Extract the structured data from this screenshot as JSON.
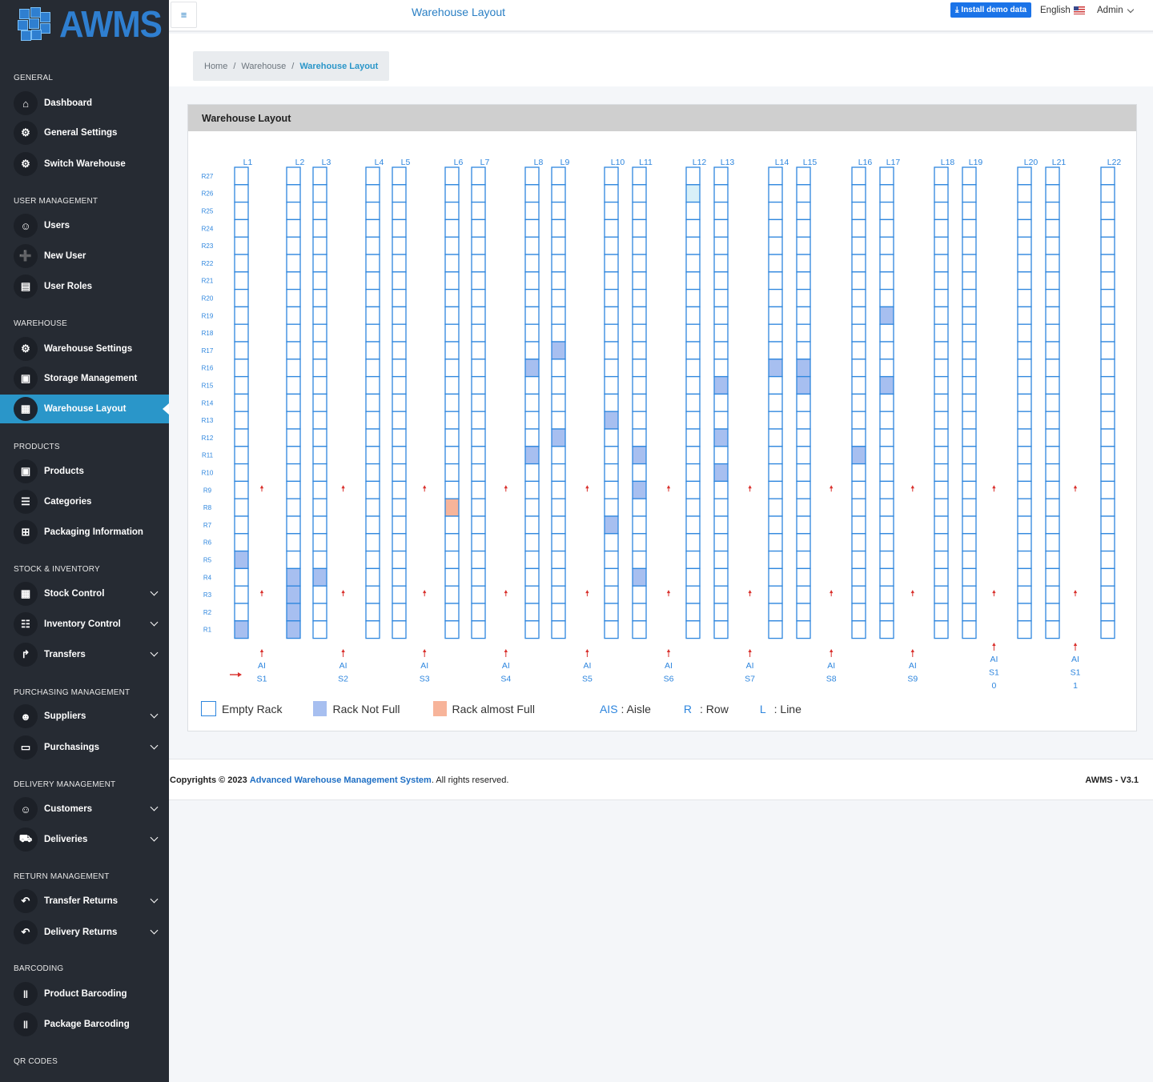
{
  "brand": {
    "name": "AWMS"
  },
  "topbar": {
    "title": "Warehouse Layout",
    "demo_button": "Install demo data",
    "language": "English",
    "user": "Admin"
  },
  "breadcrumb": {
    "home": "Home",
    "sep1": "/",
    "parent": "Warehouse",
    "sep2": "/",
    "current": "Warehouse Layout"
  },
  "sidebar": {
    "sections": [
      {
        "title": "GENERAL",
        "items": [
          {
            "label": "Dashboard",
            "icon": "home-icon"
          },
          {
            "label": "General Settings",
            "icon": "gear-icon"
          },
          {
            "label": "Switch Warehouse",
            "icon": "gear-icon"
          }
        ]
      },
      {
        "title": "USER MANAGEMENT",
        "items": [
          {
            "label": "Users",
            "icon": "users-icon"
          },
          {
            "label": "New User",
            "icon": "user-plus-icon"
          },
          {
            "label": "User Roles",
            "icon": "id-card-icon"
          }
        ]
      },
      {
        "title": "WAREHOUSE",
        "items": [
          {
            "label": "Warehouse Settings",
            "icon": "gear-icon"
          },
          {
            "label": "Storage Management",
            "icon": "box-icon"
          },
          {
            "label": "Warehouse Layout",
            "icon": "grid-icon",
            "active": true
          }
        ]
      },
      {
        "title": "PRODUCTS",
        "items": [
          {
            "label": "Products",
            "icon": "box-icon"
          },
          {
            "label": "Categories",
            "icon": "list-icon"
          },
          {
            "label": "Packaging Information",
            "icon": "table-icon"
          }
        ]
      },
      {
        "title": "STOCK & INVENTORY",
        "items": [
          {
            "label": "Stock Control",
            "icon": "grid-icon",
            "expandable": true
          },
          {
            "label": "Inventory Control",
            "icon": "server-icon",
            "expandable": true
          },
          {
            "label": "Transfers",
            "icon": "share-icon",
            "expandable": true
          }
        ]
      },
      {
        "title": "PURCHASING MANAGEMENT",
        "items": [
          {
            "label": "Suppliers",
            "icon": "user-group-icon",
            "expandable": true
          },
          {
            "label": "Purchasings",
            "icon": "credit-card-icon",
            "expandable": true
          }
        ]
      },
      {
        "title": "DELIVERY MANAGEMENT",
        "items": [
          {
            "label": "Customers",
            "icon": "users-icon",
            "expandable": true
          },
          {
            "label": "Deliveries",
            "icon": "truck-icon",
            "expandable": true
          }
        ]
      },
      {
        "title": "RETURN MANAGEMENT",
        "items": [
          {
            "label": "Transfer Returns",
            "icon": "undo-icon",
            "expandable": true
          },
          {
            "label": "Delivery Returns",
            "icon": "undo-icon",
            "expandable": true
          }
        ]
      },
      {
        "title": "BARCODING",
        "items": [
          {
            "label": "Product Barcoding",
            "icon": "barcode-icon"
          },
          {
            "label": "Package Barcoding",
            "icon": "barcode-icon"
          }
        ]
      },
      {
        "title": "QR CODES",
        "items": []
      }
    ]
  },
  "card": {
    "title": "Warehouse Layout"
  },
  "layout": {
    "lines": [
      "L1",
      "L2",
      "L3",
      "L4",
      "L5",
      "L6",
      "L7",
      "L8",
      "L9",
      "L10",
      "L11",
      "L12",
      "L13",
      "L14",
      "L15",
      "L16",
      "L17",
      "L18",
      "L19",
      "L20",
      "L21",
      "L22"
    ],
    "rows": [
      "R27",
      "R26",
      "R25",
      "R24",
      "R23",
      "R22",
      "R21",
      "R20",
      "R19",
      "R18",
      "R17",
      "R16",
      "R15",
      "R14",
      "R13",
      "R12",
      "R11",
      "R10",
      "R9",
      "R8",
      "R7",
      "R6",
      "R5",
      "R4",
      "R3",
      "R2",
      "R1"
    ],
    "aisles": [
      {
        "lines": [
          "AI",
          "S1"
        ]
      },
      {
        "lines": [
          "AI",
          "S2"
        ]
      },
      {
        "lines": [
          "AI",
          "S3"
        ]
      },
      {
        "lines": [
          "AI",
          "S4"
        ]
      },
      {
        "lines": [
          "AI",
          "S5"
        ]
      },
      {
        "lines": [
          "AI",
          "S6"
        ]
      },
      {
        "lines": [
          "AI",
          "S7"
        ]
      },
      {
        "lines": [
          "AI",
          "S8"
        ]
      },
      {
        "lines": [
          "AI",
          "S9"
        ]
      },
      {
        "lines": [
          "AI",
          "S1",
          "0"
        ]
      },
      {
        "lines": [
          "AI",
          "S1",
          "1"
        ]
      }
    ],
    "rack_status": {
      "not_full": [
        [
          "L1",
          "R5"
        ],
        [
          "L1",
          "R1"
        ],
        [
          "L2",
          "R4"
        ],
        [
          "L2",
          "R3"
        ],
        [
          "L2",
          "R2"
        ],
        [
          "L2",
          "R1"
        ],
        [
          "L3",
          "R4"
        ],
        [
          "L8",
          "R16"
        ],
        [
          "L8",
          "R11"
        ],
        [
          "L9",
          "R17"
        ],
        [
          "L9",
          "R12"
        ],
        [
          "L10",
          "R13"
        ],
        [
          "L10",
          "R7"
        ],
        [
          "L11",
          "R11"
        ],
        [
          "L11",
          "R9"
        ],
        [
          "L11",
          "R4"
        ],
        [
          "L13",
          "R15"
        ],
        [
          "L13",
          "R12"
        ],
        [
          "L13",
          "R10"
        ],
        [
          "L14",
          "R16"
        ],
        [
          "L15",
          "R16"
        ],
        [
          "L15",
          "R15"
        ],
        [
          "L16",
          "R11"
        ],
        [
          "L17",
          "R19"
        ],
        [
          "L17",
          "R15"
        ]
      ],
      "almost_full": [
        [
          "L6",
          "R8"
        ]
      ],
      "light": [
        [
          "L12",
          "R26"
        ]
      ]
    },
    "colors": {
      "empty_border": "#2e86de",
      "not_full": "#a7bff0",
      "almost_full": "#f7b49a",
      "light": "#d8f0f8",
      "label": "#2e86de",
      "arrow": "#d9302c"
    }
  },
  "legend": {
    "empty": "Empty Rack",
    "not_full": "Rack Not Full",
    "almost_full": "Rack almost Full",
    "aisle_abbr": "AIS",
    "aisle_text": ": Aisle",
    "row_abbr": "R",
    "row_text": ": Row",
    "line_abbr": "L",
    "line_text": ": Line"
  },
  "footer": {
    "copy_prefix": "Copyrights © 2023",
    "company": "Advanced Warehouse Management System",
    "copy_suffix": ". All rights reserved.",
    "version": "AWMS - V3.1"
  }
}
